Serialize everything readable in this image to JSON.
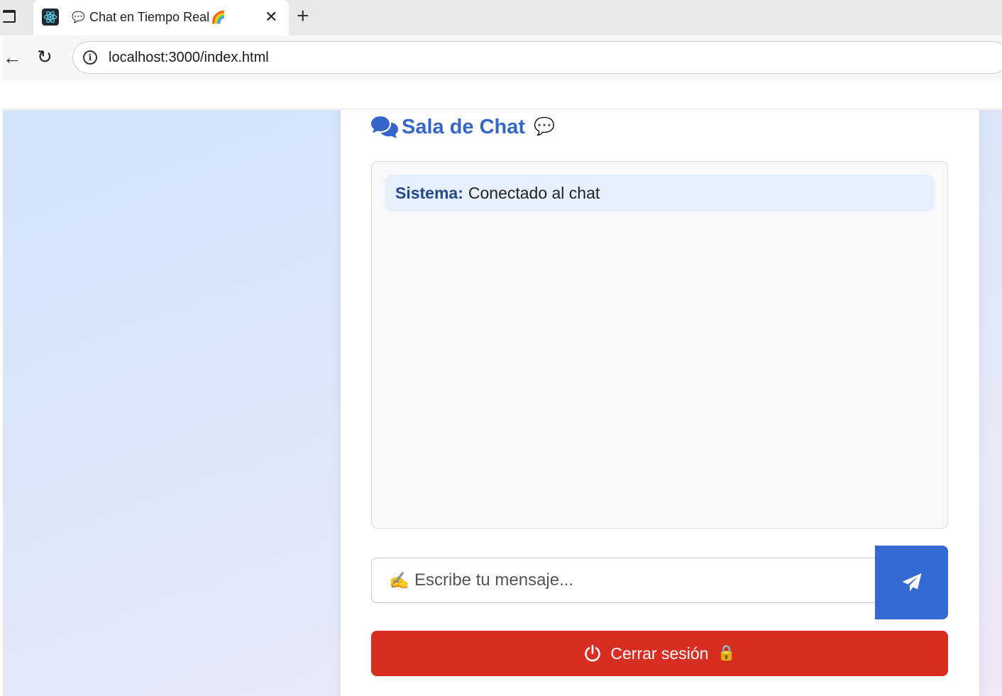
{
  "browser": {
    "tab": {
      "title_emoji": "💬",
      "title": "Chat en Tiempo Real",
      "title_suffix_emoji": "🌈",
      "close_glyph": "✕",
      "favicon": "react-icon"
    },
    "new_tab_glyph": "+",
    "back_glyph": "←",
    "reload_glyph": "↻",
    "info_glyph": "i",
    "url": "localhost:3000/index.html"
  },
  "chat": {
    "heading_icon": "comments-icon",
    "heading": "Sala de Chat",
    "heading_emoji": "💬",
    "messages": [
      {
        "sender": "Sistema:",
        "text": "Conectado al chat"
      }
    ],
    "input": {
      "emoji": "✍️",
      "placeholder": "Escribe tu mensaje..."
    },
    "send_icon": "paper-plane-icon",
    "logout": {
      "label": "Cerrar sesión",
      "emoji": "🔒"
    }
  },
  "colors": {
    "accent": "#3468d2",
    "heading": "#3465c8",
    "danger": "#d82e22",
    "message_bg": "#e6effc"
  }
}
